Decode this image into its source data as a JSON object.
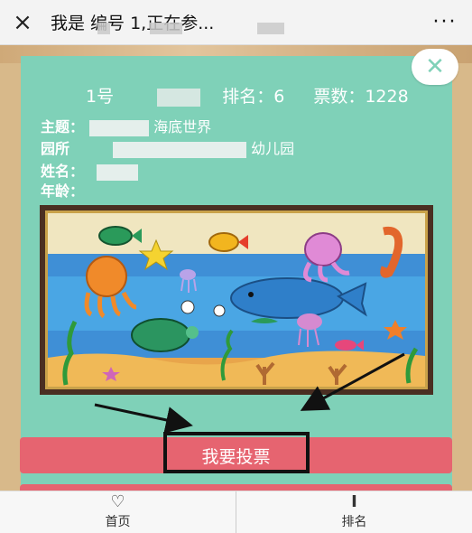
{
  "topbar": {
    "title": "我是        编号      1,正在参...",
    "close_icon": "×",
    "more_icon": "···"
  },
  "card": {
    "close_icon": "✕",
    "stats": {
      "number": "1号",
      "rank": "排名：6",
      "votes": "票数：1228"
    },
    "theme_label": "主题：",
    "theme_value": "海底世界",
    "school_label": "园所",
    "school_value": "幼儿园",
    "name_label": "姓名：",
    "age_label": "年龄："
  },
  "vote_button": "我要投票",
  "bottom_nav": {
    "home": "首页",
    "home_icon": "heart-icon",
    "rank": "排名",
    "rank_icon": "rank-icon"
  },
  "colors": {
    "card": "#7fd1b8",
    "button": "#e66470"
  }
}
